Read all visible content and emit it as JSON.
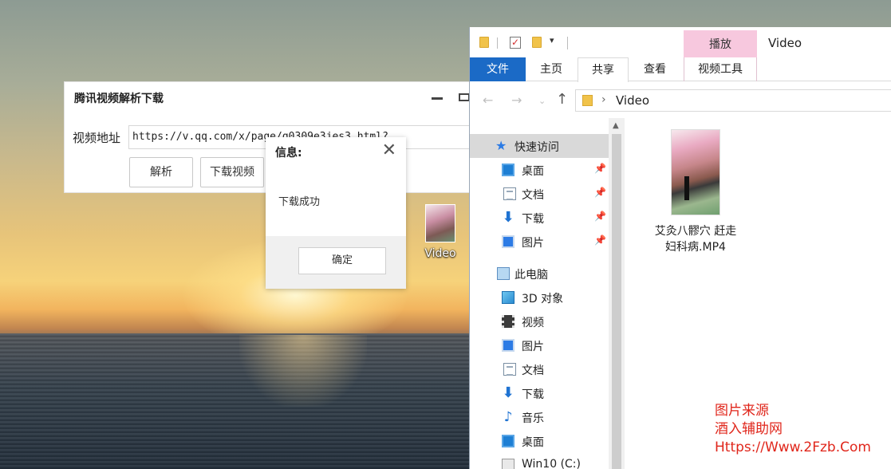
{
  "desktop": {
    "icon_label": "Video"
  },
  "app": {
    "title": "腾讯视频解析下载",
    "url_label": "视频地址",
    "url_value": "https://v.qq.com/x/page/g0309e3jes3.html?",
    "parse_button": "解析",
    "download_button": "下载视频"
  },
  "dialog": {
    "title": "信息:",
    "close": "✕",
    "message": "下载成功",
    "ok_button": "确定"
  },
  "explorer": {
    "window_title": "Video",
    "context_tab": "播放",
    "ribbon_tabs": {
      "file": "文件",
      "home": "主页",
      "share": "共享",
      "view": "查看",
      "video_tools": "视频工具"
    },
    "address_path": "Video",
    "nav": {
      "quick_access": "快速访问",
      "quick_items": [
        {
          "label": "桌面",
          "icon": "desktop-icon"
        },
        {
          "label": "文档",
          "icon": "documents-icon"
        },
        {
          "label": "下载",
          "icon": "downloads-icon"
        },
        {
          "label": "图片",
          "icon": "pictures-icon"
        }
      ],
      "this_pc": "此电脑",
      "pc_items": [
        {
          "label": "3D 对象",
          "icon": "3d-objects-icon"
        },
        {
          "label": "视频",
          "icon": "videos-icon"
        },
        {
          "label": "图片",
          "icon": "pictures-icon"
        },
        {
          "label": "文档",
          "icon": "documents-icon"
        },
        {
          "label": "下载",
          "icon": "downloads-icon"
        },
        {
          "label": "音乐",
          "icon": "music-icon"
        },
        {
          "label": "桌面",
          "icon": "desktop-icon"
        },
        {
          "label": "Win10 (C:)",
          "icon": "drive-icon"
        }
      ]
    },
    "file": {
      "name_line1": "艾灸八髎穴 赶走",
      "name_line2": "妇科病.MP4"
    }
  },
  "watermark": {
    "line1": "图片来源",
    "line2": "酒入辅助网",
    "line3": "Https://Www.2Fzb.Com"
  },
  "colors": {
    "ribbon_file_tab": "#1b6ac6",
    "context_tab": "#f7c8de",
    "watermark": "#e0261b"
  }
}
